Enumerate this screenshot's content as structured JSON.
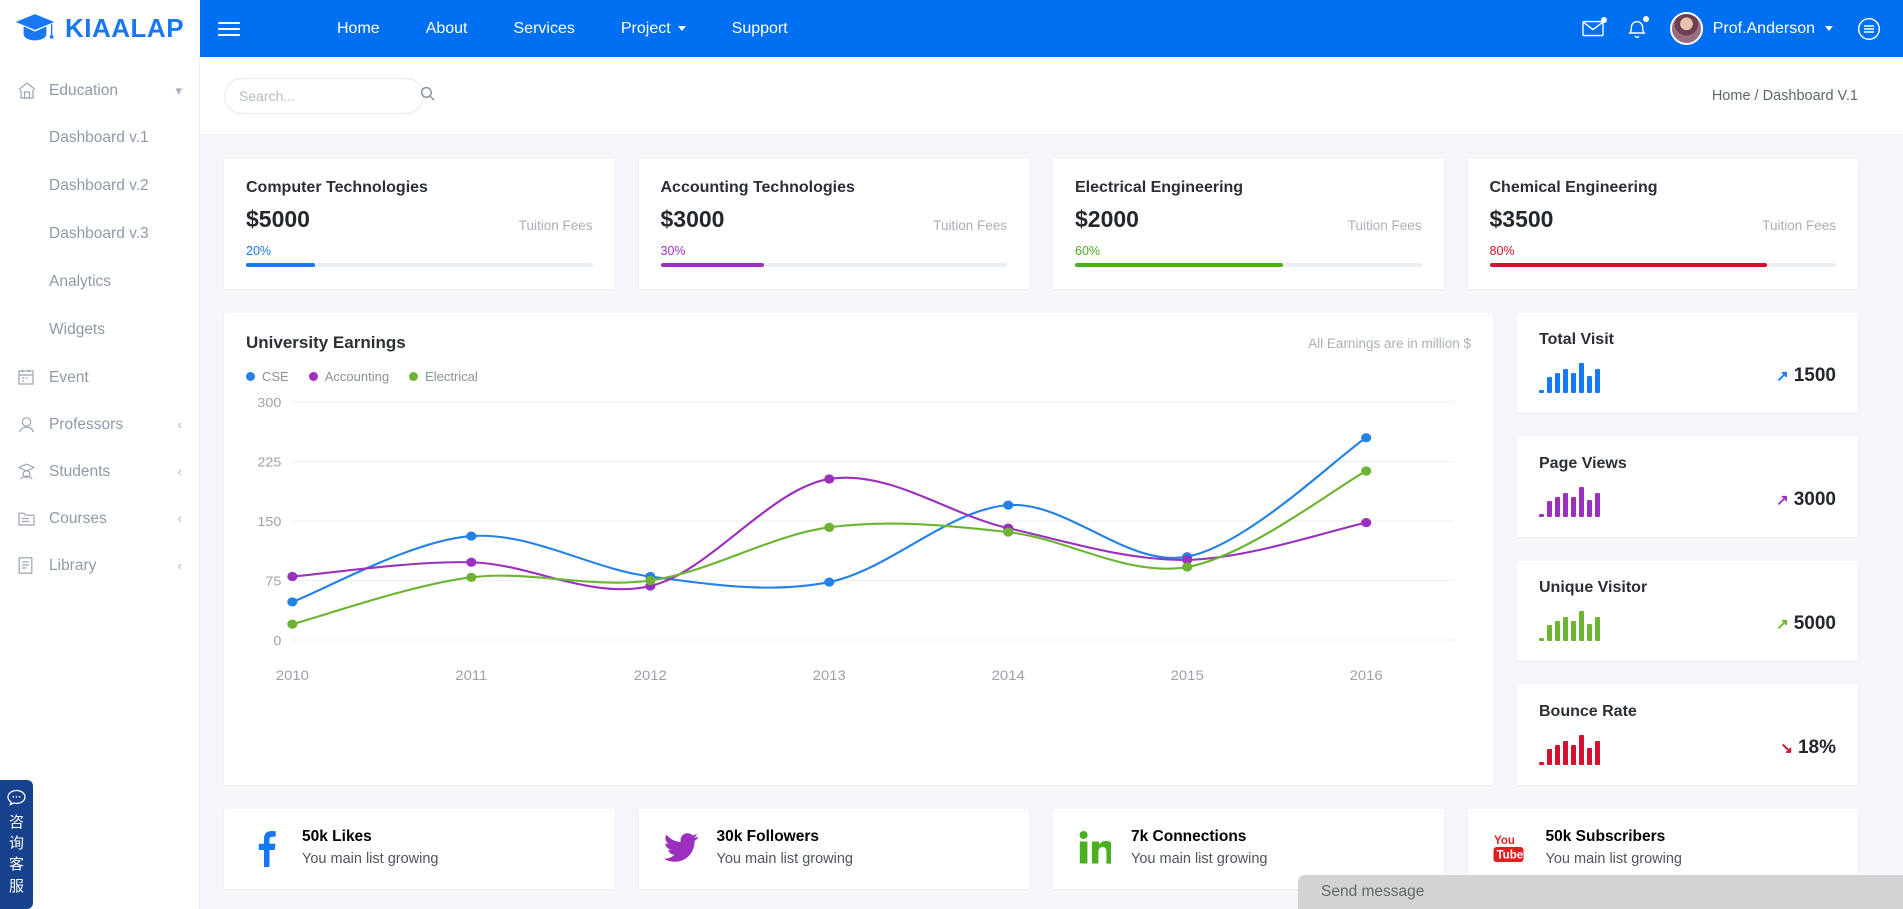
{
  "brand": {
    "name": "KIAALAP",
    "logo_icon": "graduation-cap-icon"
  },
  "nav": {
    "menu_icon": "hamburger-icon",
    "links": [
      {
        "label": "Home",
        "has_caret": false
      },
      {
        "label": "About",
        "has_caret": false
      },
      {
        "label": "Services",
        "has_caret": false
      },
      {
        "label": "Project",
        "has_caret": true
      },
      {
        "label": "Support",
        "has_caret": false
      }
    ],
    "mail_icon": "envelope-icon",
    "bell_icon": "bell-icon",
    "user_name": "Prof.Anderson",
    "menu_right_icon": "list-circle-icon"
  },
  "sidebar": {
    "items": [
      {
        "label": "Education",
        "icon": "home-icon",
        "arrow": "chevron-down",
        "type": "parent"
      },
      {
        "label": "Dashboard v.1",
        "type": "sub"
      },
      {
        "label": "Dashboard v.2",
        "type": "sub"
      },
      {
        "label": "Dashboard v.3",
        "type": "sub"
      },
      {
        "label": "Analytics",
        "type": "sub"
      },
      {
        "label": "Widgets",
        "type": "sub"
      },
      {
        "label": "Event",
        "icon": "calendar-icon",
        "arrow": "",
        "type": "parent"
      },
      {
        "label": "Professors",
        "icon": "professor-icon",
        "arrow": "chevron-left",
        "type": "parent"
      },
      {
        "label": "Students",
        "icon": "student-icon",
        "arrow": "chevron-left",
        "type": "parent"
      },
      {
        "label": "Courses",
        "icon": "folder-icon",
        "arrow": "chevron-left",
        "type": "parent"
      },
      {
        "label": "Library",
        "icon": "book-icon",
        "arrow": "chevron-left",
        "type": "parent"
      }
    ]
  },
  "search": {
    "placeholder": "Search...",
    "value": "",
    "icon": "search-icon"
  },
  "breadcrumb": "Home / Dashboard V.1",
  "stat_cards": [
    {
      "title": "Computer Technologies",
      "amount": "$5000",
      "sub": "Tuition Fees",
      "pct": "20%",
      "pct_value": 20,
      "color": "#1878f3"
    },
    {
      "title": "Accounting Technologies",
      "amount": "$3000",
      "sub": "Tuition Fees",
      "pct": "30%",
      "pct_value": 30,
      "color": "#9b30bf"
    },
    {
      "title": "Electrical Engineering",
      "amount": "$2000",
      "sub": "Tuition Fees",
      "pct": "60%",
      "pct_value": 60,
      "color": "#4caf20"
    },
    {
      "title": "Chemical Engineering",
      "amount": "$3500",
      "sub": "Tuition Fees",
      "pct": "80%",
      "pct_value": 80,
      "color": "#d3112e"
    }
  ],
  "chart_card": {
    "title": "University Earnings",
    "note": "All Earnings are in million $"
  },
  "chart_data": {
    "type": "line",
    "title": "University Earnings",
    "subtitle": "All Earnings are in million $",
    "xlabel": "",
    "ylabel": "",
    "x": [
      "2010",
      "2011",
      "2012",
      "2013",
      "2014",
      "2015",
      "2016"
    ],
    "categories": [
      "2010",
      "2011",
      "2012",
      "2013",
      "2014",
      "2015",
      "2016"
    ],
    "yticks": [
      0,
      75,
      150,
      225,
      300
    ],
    "ylim": [
      0,
      300
    ],
    "grid": true,
    "legend_position": "top-left",
    "series": [
      {
        "name": "CSE",
        "color": "#2481e8",
        "values": [
          48,
          131,
          80,
          73,
          170,
          105,
          255
        ]
      },
      {
        "name": "Accounting",
        "color": "#9b30bf",
        "values": [
          80,
          98,
          68,
          203,
          141,
          101,
          148
        ]
      },
      {
        "name": "Electrical",
        "color": "#6cb432",
        "values": [
          20,
          79,
          75,
          142,
          136,
          92,
          213
        ]
      }
    ]
  },
  "mini_stats": [
    {
      "title": "Total Visit",
      "value": "1500",
      "trend": "up",
      "trend_icon": "arrow-up-icon",
      "color": "#1878f3",
      "bars": [
        9,
        48,
        60,
        72,
        58,
        88,
        50,
        70
      ]
    },
    {
      "title": "Page Views",
      "value": "3000",
      "trend": "up",
      "trend_icon": "arrow-up-icon",
      "color": "#9b30bf",
      "bars": [
        9,
        48,
        60,
        72,
        58,
        88,
        50,
        70
      ]
    },
    {
      "title": "Unique Visitor",
      "value": "5000",
      "trend": "up",
      "trend_icon": "arrow-up-icon",
      "color": "#6cb432",
      "bars": [
        9,
        48,
        60,
        72,
        58,
        88,
        50,
        70
      ]
    },
    {
      "title": "Bounce Rate",
      "value": "18%",
      "trend": "down",
      "trend_icon": "arrow-down-icon",
      "color": "#d3112e",
      "bars": [
        9,
        48,
        60,
        72,
        58,
        88,
        50,
        70
      ]
    }
  ],
  "social_cards": [
    {
      "network": "facebook",
      "icon": "facebook-icon",
      "count": "50k Likes",
      "sub": "You main list growing",
      "color": "#1878f3"
    },
    {
      "network": "twitter",
      "icon": "twitter-icon",
      "count": "30k Followers",
      "sub": "You main list growing",
      "color": "#9b30bf"
    },
    {
      "network": "linkedin",
      "icon": "linkedin-icon",
      "count": "7k Connections",
      "sub": "You main list growing",
      "color": "#4caf20"
    },
    {
      "network": "youtube",
      "icon": "youtube-icon",
      "count": "50k Subscribers",
      "sub": "You main list growing",
      "color": "#e02020"
    }
  ],
  "chat": {
    "tab_icon": "chat-bubble-icon",
    "tab_text": "咨询客服",
    "send_label": "Send message"
  }
}
